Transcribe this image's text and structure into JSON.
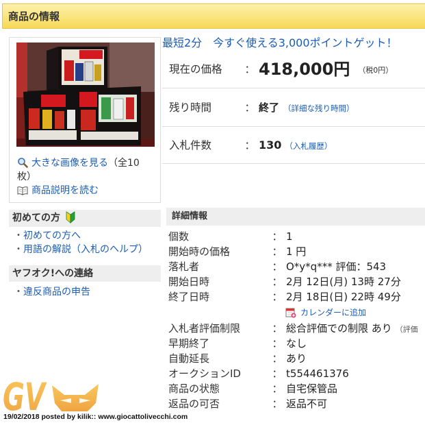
{
  "header": {
    "title": "商品の情報"
  },
  "gallery": {
    "view_larger_label": "大きな画像を見る",
    "view_larger_count": "（全10枚）",
    "read_description_label": "商品説明を読む"
  },
  "promo": {
    "text": "最短2分　今すぐ使える3,000ポイントゲット！"
  },
  "separator": "：",
  "summary": {
    "price": {
      "label": "現在の価格",
      "value": "418,000円",
      "tax_note": "（税0円）"
    },
    "time_left": {
      "label": "残り時間",
      "value": "終了",
      "detail_link": "（詳細な残り時間）"
    },
    "bids": {
      "label": "入札件数",
      "value": "130",
      "history_link": "（入札履歴）"
    }
  },
  "beginner": {
    "title": "初めての方",
    "bullet": "・",
    "items": [
      "初めての方へ",
      "用語の解説（入札のヘルプ）"
    ]
  },
  "contact": {
    "title": "ヤフオク!への連絡",
    "items": [
      "違反商品の申告"
    ]
  },
  "details": {
    "title": "詳細情報",
    "rows": [
      {
        "label": "個数",
        "value": "1"
      },
      {
        "label": "開始時の価格",
        "value": "1 円"
      },
      {
        "label": "落札者",
        "value": "O*y*q*** 評価：543"
      },
      {
        "label": "開始日時",
        "value": "2月 12日(月) 13時 27分"
      },
      {
        "label": "終了日時",
        "value": "2月 18日(日) 22時 49分"
      },
      {
        "label": "入札者評価制限",
        "value": "総合評価での制限 あり",
        "trail": "（評価"
      },
      {
        "label": "早期終了",
        "value": "なし"
      },
      {
        "label": "自動延長",
        "value": "あり"
      },
      {
        "label": "オークションID",
        "value": "t554461376"
      },
      {
        "label": "商品の状態",
        "value": "自宅保管品"
      },
      {
        "label": "返品の可否",
        "value": "返品不可"
      }
    ],
    "calendar_link": "カレンダーに追加"
  },
  "watermark": {
    "logo_text": "GV",
    "caption": "19/02/2018 posted by kilik:: www.giocattolivecchi.com"
  },
  "icons": {
    "view_larger": "magnifier-icon",
    "read_description": "book-icon",
    "beginner": "beginner-mark-icon",
    "calendar": "calendar-add-icon",
    "watermark": "mask-logo-icon"
  },
  "colors": {
    "header_bg": "#f7d958",
    "link": "#1c5cb4",
    "section_bg": "#eeeeee",
    "divider": "#dddddd",
    "watermark": "#f0a838"
  }
}
